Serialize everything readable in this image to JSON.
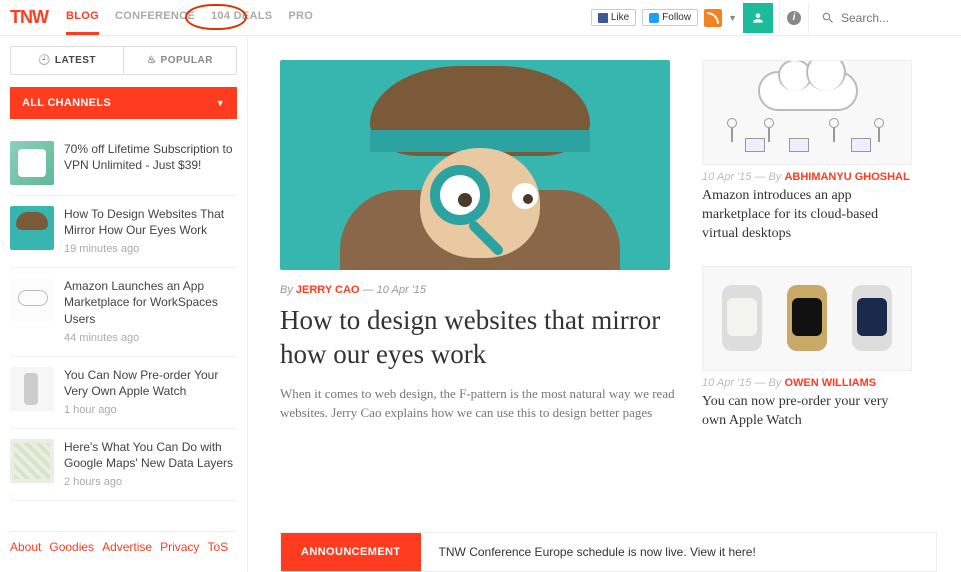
{
  "nav": {
    "logo": "TNW",
    "links": [
      "BLOG",
      "CONFERENCE",
      "104 DEALS",
      "PRO"
    ],
    "like": "Like",
    "follow": "Follow",
    "search_placeholder": "Search..."
  },
  "sidebar": {
    "tabs": {
      "latest": "LATEST",
      "popular": "POPULAR"
    },
    "channels": "ALL CHANNELS",
    "items": [
      {
        "title": "70% off Lifetime Subscription to VPN Unlimited - Just $39!",
        "ago": ""
      },
      {
        "title": "How To Design Websites That Mirror How Our Eyes Work",
        "ago": "19 minutes ago"
      },
      {
        "title": "Amazon Launches an App Marketplace for WorkSpaces Users",
        "ago": "44 minutes ago"
      },
      {
        "title": "You Can Now Pre-order Your Very Own Apple Watch",
        "ago": "1 hour ago"
      },
      {
        "title": "Here's What You Can Do with Google Maps' New Data Layers",
        "ago": "2 hours ago"
      }
    ],
    "footer": [
      "About",
      "Goodies",
      "Advertise",
      "Privacy",
      "ToS"
    ]
  },
  "feature": {
    "by": "By",
    "author": "JERRY CAO",
    "date": "10 Apr '15",
    "headline": "How to design websites that mirror how our eyes work",
    "excerpt": "When it comes to web design, the F-pattern is the most natural way we read websites. Jerry Cao explains how we can use this to design better pages"
  },
  "cards": [
    {
      "date": "10 Apr '15",
      "by": "By",
      "author": "ABHIMANYU GHOSHAL",
      "title": "Amazon introduces an app marketplace for its cloud-based virtual desktops"
    },
    {
      "date": "10 Apr '15",
      "by": "By",
      "author": "OWEN WILLIAMS",
      "title": "You can now pre-order your very own Apple Watch"
    }
  ],
  "announce": {
    "tag": "ANNOUNCEMENT",
    "text": "TNW Conference Europe schedule is now live. View it here!"
  }
}
